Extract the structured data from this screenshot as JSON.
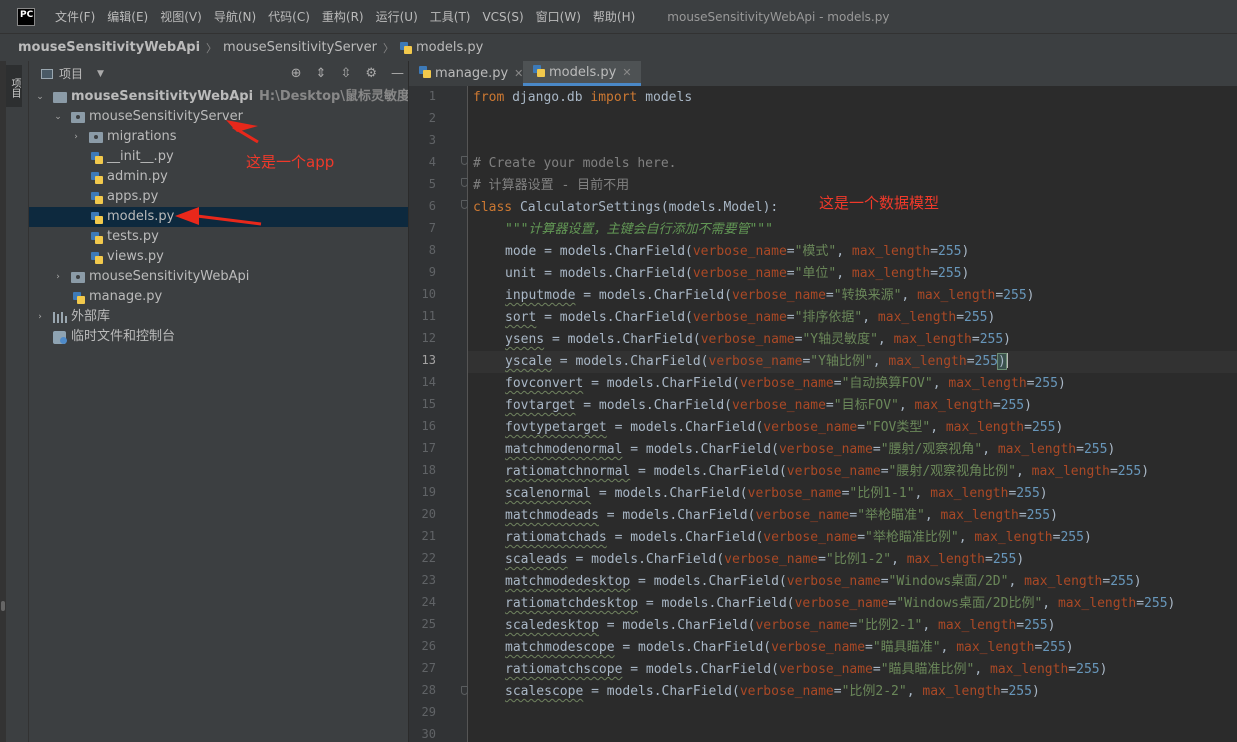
{
  "app": {
    "icon_label": "PC",
    "window_title": "mouseSensitivityWebApi - models.py"
  },
  "menu": [
    "文件(F)",
    "编辑(E)",
    "视图(V)",
    "导航(N)",
    "代码(C)",
    "重构(R)",
    "运行(U)",
    "工具(T)",
    "VCS(S)",
    "窗口(W)",
    "帮助(H)"
  ],
  "breadcrumb": [
    "mouseSensitivityWebApi",
    "mouseSensitivityServer",
    "models.py"
  ],
  "left_strip": {
    "tab_label": "项目"
  },
  "project_panel": {
    "title": "项目",
    "root_name": "mouseSensitivityWebApi",
    "root_path": "H:\\Desktop\\鼠标灵敏度转换\\mo",
    "items": {
      "server": "mouseSensitivityServer",
      "migrations": "migrations",
      "init": "__init__.py",
      "admin": "admin.py",
      "apps": "apps.py",
      "models": "models.py",
      "tests": "tests.py",
      "views": "views.py",
      "webapi": "mouseSensitivityWebApi",
      "manage": "manage.py",
      "extlib": "外部库",
      "scratch": "临时文件和控制台"
    }
  },
  "annotations": {
    "app_note": "这是一个app",
    "model_note": "这是一个数据模型"
  },
  "tabs": [
    "manage.py",
    "models.py"
  ],
  "editor": {
    "line_numbers": [
      "1",
      "2",
      "3",
      "4",
      "5",
      "6",
      "7",
      "8",
      "9",
      "10",
      "11",
      "12",
      "13",
      "14",
      "15",
      "16",
      "17",
      "18",
      "19",
      "20",
      "21",
      "22",
      "23",
      "24",
      "25",
      "26",
      "27",
      "28",
      "29",
      "30"
    ],
    "current_line": 13,
    "code": {
      "import": {
        "kw1": "from",
        "module": " django.db ",
        "kw2": "import",
        "name": " models"
      },
      "comment1": "# Create your models here.",
      "comment2": "# 计算器设置 - 目前不用",
      "class_kw": "class",
      "class_decl": " CalculatorSettings(models.Model):",
      "docstring": "\"\"\"计算器设置，主键会自行添加不需要管\"\"\"",
      "call": " = models.CharField(",
      "kw_verbose": "verbose_name",
      "eq": "=",
      "sep": ", ",
      "kw_max": "max_length",
      "max_val": "255",
      "close": ")",
      "fields": [
        {
          "name": "mode",
          "verbose": "\"模式\""
        },
        {
          "name": "unit",
          "verbose": "\"单位\""
        },
        {
          "name": "inputmode",
          "verbose": "\"转换来源\""
        },
        {
          "name": "sort",
          "verbose": "\"排序依据\""
        },
        {
          "name": "ysens",
          "verbose": "\"Y轴灵敏度\""
        },
        {
          "name": "yscale",
          "verbose": "\"Y轴比例\""
        },
        {
          "name": "fovconvert",
          "verbose": "\"自动换算FOV\""
        },
        {
          "name": "fovtarget",
          "verbose": "\"目标FOV\""
        },
        {
          "name": "fovtypetarget",
          "verbose": "\"FOV类型\""
        },
        {
          "name": "matchmodenormal",
          "verbose": "\"腰射/观察视角\""
        },
        {
          "name": "ratiomatchnormal",
          "verbose": "\"腰射/观察视角比例\""
        },
        {
          "name": "scalenormal",
          "verbose": "\"比例1-1\""
        },
        {
          "name": "matchmodeads",
          "verbose": "\"举枪瞄准\""
        },
        {
          "name": "ratiomatchads",
          "verbose": "\"举枪瞄准比例\""
        },
        {
          "name": "scaleads",
          "verbose": "\"比例1-2\""
        },
        {
          "name": "matchmodedesktop",
          "verbose": "\"Windows桌面/2D\""
        },
        {
          "name": "ratiomatchdesktop",
          "verbose": "\"Windows桌面/2D比例\""
        },
        {
          "name": "scaledesktop",
          "verbose": "\"比例2-1\""
        },
        {
          "name": "matchmodescope",
          "verbose": "\"瞄具瞄准\""
        },
        {
          "name": "ratiomatchscope",
          "verbose": "\"瞄具瞄准比例\""
        },
        {
          "name": "scalescope",
          "verbose": "\"比例2-2\""
        }
      ]
    }
  }
}
